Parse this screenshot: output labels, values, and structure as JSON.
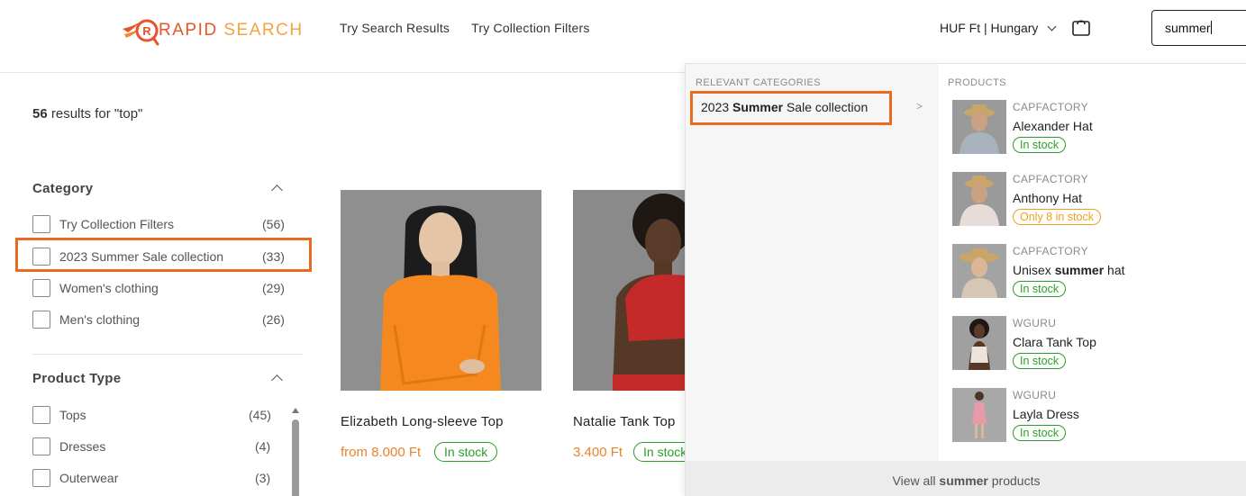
{
  "header": {
    "logo": {
      "rapid": "RAPID",
      "search": " SEARCH"
    },
    "nav": [
      "Try Search Results",
      "Try Collection Filters"
    ],
    "currency": "HUF Ft | Hungary",
    "search_value": "summer"
  },
  "results": {
    "count": "56",
    "text": " results for \"top\""
  },
  "facets": {
    "category": {
      "title": "Category",
      "items": [
        {
          "label": "Try Collection Filters",
          "count": "(56)"
        },
        {
          "label": "2023 Summer Sale collection",
          "count": "(33)"
        },
        {
          "label": "Women's clothing",
          "count": "(29)"
        },
        {
          "label": "Men's clothing",
          "count": "(26)"
        }
      ]
    },
    "product_type": {
      "title": "Product Type",
      "items": [
        {
          "label": "Tops",
          "count": "(45)"
        },
        {
          "label": "Dresses",
          "count": "(4)"
        },
        {
          "label": "Outerwear",
          "count": "(3)"
        }
      ]
    }
  },
  "products": [
    {
      "name": "Elizabeth Long-sleeve Top",
      "price": "from 8.000 Ft",
      "stock": "In stock"
    },
    {
      "name": "Natalie Tank Top",
      "price": "3.400 Ft",
      "stock": "In stock"
    }
  ],
  "dropdown": {
    "categories_heading": "RELEVANT CATEGORIES",
    "category": {
      "pre": "2023 ",
      "bold": "Summer",
      "post": " Sale collection"
    },
    "category_arrow": ">",
    "products_heading": "PRODUCTS",
    "products": [
      {
        "vendor": "CAPFACTORY",
        "title_pre": "Alexander Hat",
        "title_bold": "",
        "title_post": "",
        "stock": "In stock",
        "low": false
      },
      {
        "vendor": "CAPFACTORY",
        "title_pre": "Anthony Hat",
        "title_bold": "",
        "title_post": "",
        "stock": "Only 8 in stock",
        "low": true
      },
      {
        "vendor": "CAPFACTORY",
        "title_pre": "Unisex ",
        "title_bold": "summer",
        "title_post": " hat",
        "stock": "In stock",
        "low": false
      },
      {
        "vendor": "WGURU",
        "title_pre": "Clara Tank Top",
        "title_bold": "",
        "title_post": "",
        "stock": "In stock",
        "low": false
      },
      {
        "vendor": "WGURU",
        "title_pre": "Layla Dress",
        "title_bold": "",
        "title_post": "",
        "stock": "In stock",
        "low": false
      }
    ],
    "footer": {
      "pre": "View all ",
      "bold": "summer",
      "post": " products"
    }
  },
  "colors": {
    "accent": "#e96b1f",
    "in_stock": "#2a9d2a",
    "low_stock": "#f0a020",
    "price": "#e8842a"
  }
}
